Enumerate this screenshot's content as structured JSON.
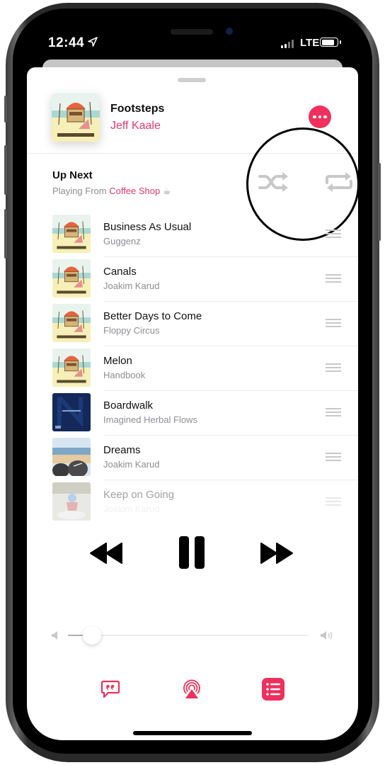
{
  "status_bar": {
    "time": "12:44",
    "network": "LTE",
    "signal_bars_active": 2,
    "signal_bars_total": 4,
    "battery_level": 0.85
  },
  "now_playing": {
    "title": "Footsteps",
    "artist": "Jeff Kaale",
    "album_art": "chillhop-essentials-beach-hut",
    "more_button_icon": "ellipsis-icon"
  },
  "up_next": {
    "title": "Up Next",
    "playing_from_prefix": "Playing From",
    "playlist_name": "Coffee Shop",
    "playlist_emoji": "☕",
    "shuffle_icon": "shuffle-icon",
    "repeat_icon": "repeat-icon",
    "shuffle_enabled": false,
    "repeat_enabled": false
  },
  "queue": [
    {
      "title": "Business As Usual",
      "artist": "Guggenz",
      "art": "chillhop"
    },
    {
      "title": "Canals",
      "artist": "Joakim Karud",
      "art": "chillhop"
    },
    {
      "title": "Better Days to Come",
      "artist": "Floppy Circus",
      "art": "chillhop"
    },
    {
      "title": "Melon",
      "artist": "Handbook",
      "art": "chillhop"
    },
    {
      "title": "Boardwalk",
      "artist": "Imagined Herbal Flows",
      "art": "navy"
    },
    {
      "title": "Dreams",
      "artist": "Joakim Karud",
      "art": "beach-shoes"
    },
    {
      "title": "Keep on Going",
      "artist": "Joakim Karud",
      "art": "motocross"
    }
  ],
  "transport": {
    "previous_icon": "rewind-icon",
    "pause_icon": "pause-icon",
    "next_icon": "fast-forward-icon",
    "is_playing": true
  },
  "volume": {
    "level": 0.06,
    "low_icon": "speaker-low-icon",
    "high_icon": "speaker-high-icon"
  },
  "bottom_bar": {
    "lyrics_icon": "lyrics-quote-icon",
    "airplay_icon": "airplay-audio-icon",
    "queue_icon": "queue-list-icon",
    "queue_active": true
  },
  "colors": {
    "accent": "#f0305c",
    "artist_pink": "#e23a6b",
    "secondary_text": "#8e8e93",
    "inactive_icon": "#c8c8c8"
  }
}
